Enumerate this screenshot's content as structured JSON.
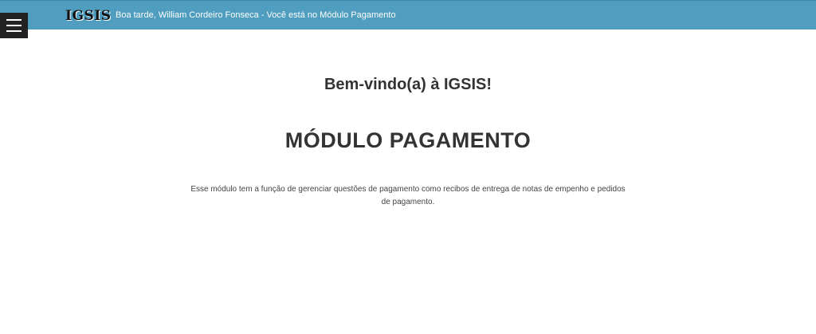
{
  "header": {
    "logo": "IGSIS",
    "greeting": "Boa tarde, William Cordeiro Fonseca - Você está no Módulo Pagamento",
    "menu_icon": "hamburger-menu-icon",
    "background_color": "#4f9dbf"
  },
  "main": {
    "welcome": "Bem-vindo(a) à IGSIS!",
    "module_title": "MÓDULO PAGAMENTO",
    "description": "Esse módulo tem a função de gerenciar questões de pagamento como recibos de entrega de notas de empenho e pedidos de pagamento."
  }
}
